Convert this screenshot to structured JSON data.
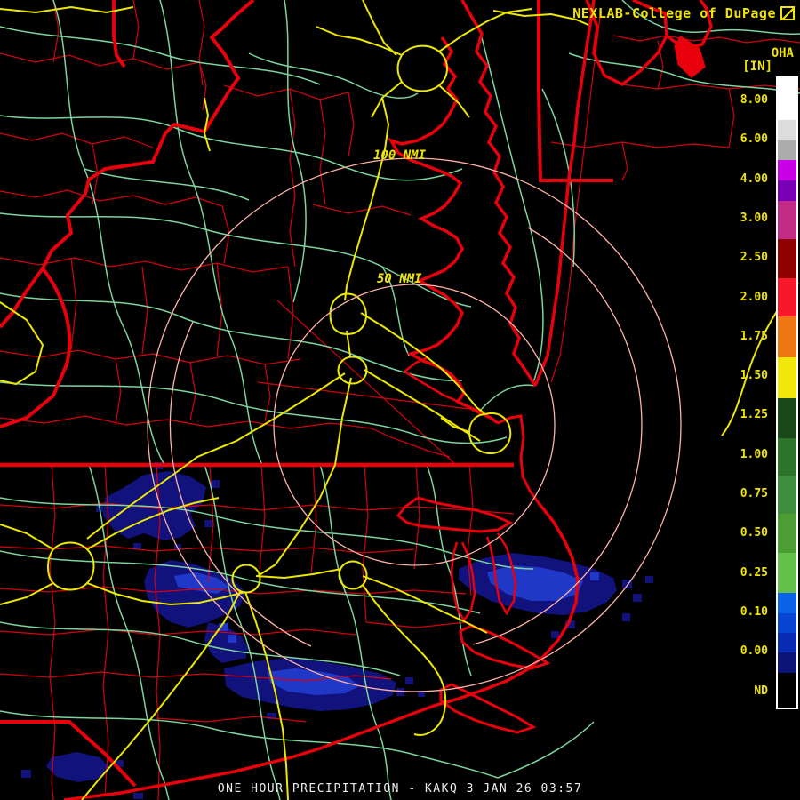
{
  "header": {
    "title": "NEXLAB-College of DuPage",
    "logo_icon": "box-diagonal-icon"
  },
  "colorbar": {
    "product_label": "OHA",
    "units_label": "[IN]",
    "nd_label": "ND",
    "tick_labels": [
      "8.00",
      "6.00",
      "4.00",
      "3.00",
      "2.50",
      "2.00",
      "1.75",
      "1.50",
      "1.25",
      "1.00",
      "0.75",
      "0.50",
      "0.25",
      "0.10",
      "0.00"
    ],
    "segments": [
      {
        "color": "#ffffff",
        "h": 47
      },
      {
        "color": "#dcdcdc",
        "h": 23
      },
      {
        "color": "#acacac",
        "h": 22
      },
      {
        "color": "#c800e6",
        "h": 23
      },
      {
        "color": "#7800b4",
        "h": 23
      },
      {
        "color": "#c22c86",
        "h": 43
      },
      {
        "color": "#8e0000",
        "h": 44
      },
      {
        "color": "#f8182c",
        "h": 43
      },
      {
        "color": "#ee7714",
        "h": 46
      },
      {
        "color": "#f0e80c",
        "h": 46
      },
      {
        "color": "#1a481a",
        "h": 45
      },
      {
        "color": "#2c742c",
        "h": 42
      },
      {
        "color": "#3e8e3e",
        "h": 43
      },
      {
        "color": "#4c9e34",
        "h": 44
      },
      {
        "color": "#64c04a",
        "h": 45
      },
      {
        "color": "#0a62e6",
        "h": 23
      },
      {
        "color": "#0846d2",
        "h": 22
      },
      {
        "color": "#0a2cb2",
        "h": 22
      },
      {
        "color": "#0c1478",
        "h": 23
      },
      {
        "color": "#000000",
        "h": 39
      }
    ]
  },
  "rings": {
    "label_100": "100 NMI",
    "label_50": "50 NMI"
  },
  "caption": {
    "text": "ONE HOUR PRECIPITATION - KAKQ 3 JAN 26 03:57"
  },
  "colors": {
    "background": "#000000",
    "border_red": "#e8000c",
    "county_red": "#d40010",
    "road_teal": "#7cd49e",
    "road_yellow": "#ede800",
    "ring_pink": "#ffb2a6",
    "precip_dark_blue": "#12127c",
    "precip_bright_blue": "#2038c8",
    "label_yellow": "#f0e400",
    "caption_white": "#ededed"
  }
}
